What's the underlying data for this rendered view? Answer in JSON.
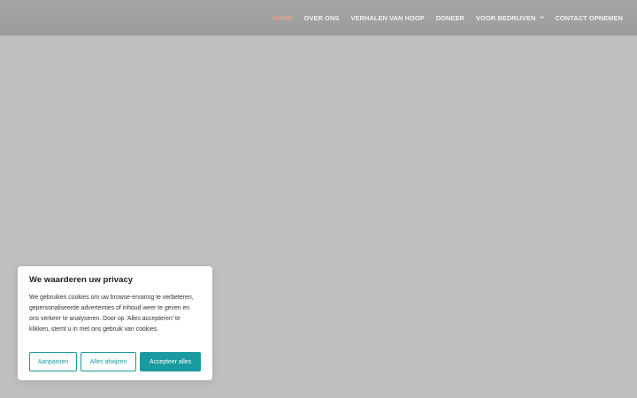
{
  "colors": {
    "page_background": "#bfbfbf",
    "header_background": "#a1a1a1",
    "nav_text": "#f2f2f2",
    "nav_active": "#e7a08f",
    "accent": "#1a9aa0",
    "banner_background": "#ffffff"
  },
  "nav": {
    "items": [
      {
        "label": "HOME",
        "active": true
      },
      {
        "label": "OVER ONS"
      },
      {
        "label": "VERHALEN VAN HOOP"
      },
      {
        "label": "DONEER"
      },
      {
        "label": "VOOR BEDRIJVEN",
        "icon": "chevron-down-icon"
      },
      {
        "label": "CONTACT OPNEMEN"
      }
    ]
  },
  "cookie_banner": {
    "title": "We waarderen uw privacy",
    "text": "We gebruiken cookies om uw browse-ervaring te verbeteren, gepersonaliseerde advertenties of inhoud weer te geven en ons verkeer te analyseren. Door op 'Alles accepteren' te klikken, stemt u in met ons gebruik van cookies.",
    "customize_label": "Aanpassen",
    "reject_label": "Alles afwijzen",
    "accept_label": "Accepteer alles"
  }
}
